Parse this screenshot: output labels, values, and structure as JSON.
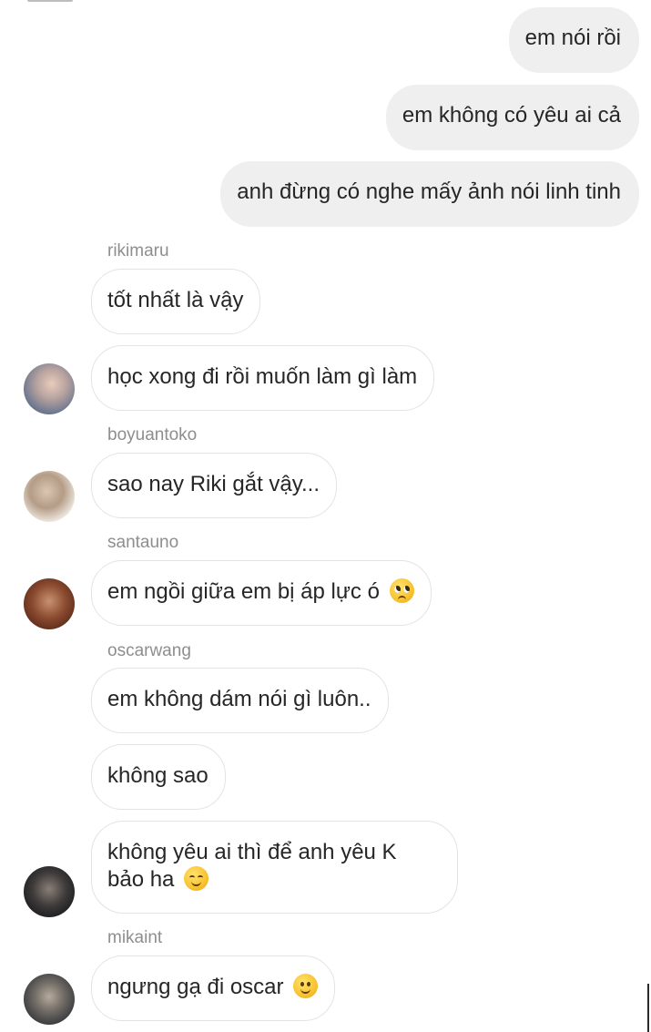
{
  "messages": {
    "m1": {
      "text": "em nói rồi"
    },
    "m2": {
      "text": "em không có yêu ai cả"
    },
    "m3": {
      "text": "anh đừng có nghe mấy ảnh nói linh tinh"
    },
    "m4": {
      "sender": "rikimaru",
      "text": "tốt nhất là vậy"
    },
    "m5": {
      "text": "học xong đi rồi muốn làm gì làm"
    },
    "m6": {
      "sender": "boyuantoko",
      "text": "sao nay Riki gắt vậy..."
    },
    "m7": {
      "sender": "santauno",
      "text": "em ngồi giữa em bị áp lực ó",
      "emoji": "pleading-face-emoji"
    },
    "m8": {
      "sender": "oscarwang",
      "text": "em không dám nói gì luôn.."
    },
    "m9": {
      "text": "không sao"
    },
    "m10": {
      "text_line1": "không yêu ai thì để anh yêu K",
      "text_line2": "bảo ha",
      "emoji": "smiling-blush-emoji"
    },
    "m11": {
      "sender": "mikaint",
      "text": "ngưng gạ đi oscar",
      "emoji": "slightly-smiling-emoji"
    }
  },
  "colors": {
    "outgoing_bubble": "#efefef",
    "incoming_border": "#e3e3e3",
    "sender_name": "#8e8e8e",
    "text": "#262626"
  }
}
